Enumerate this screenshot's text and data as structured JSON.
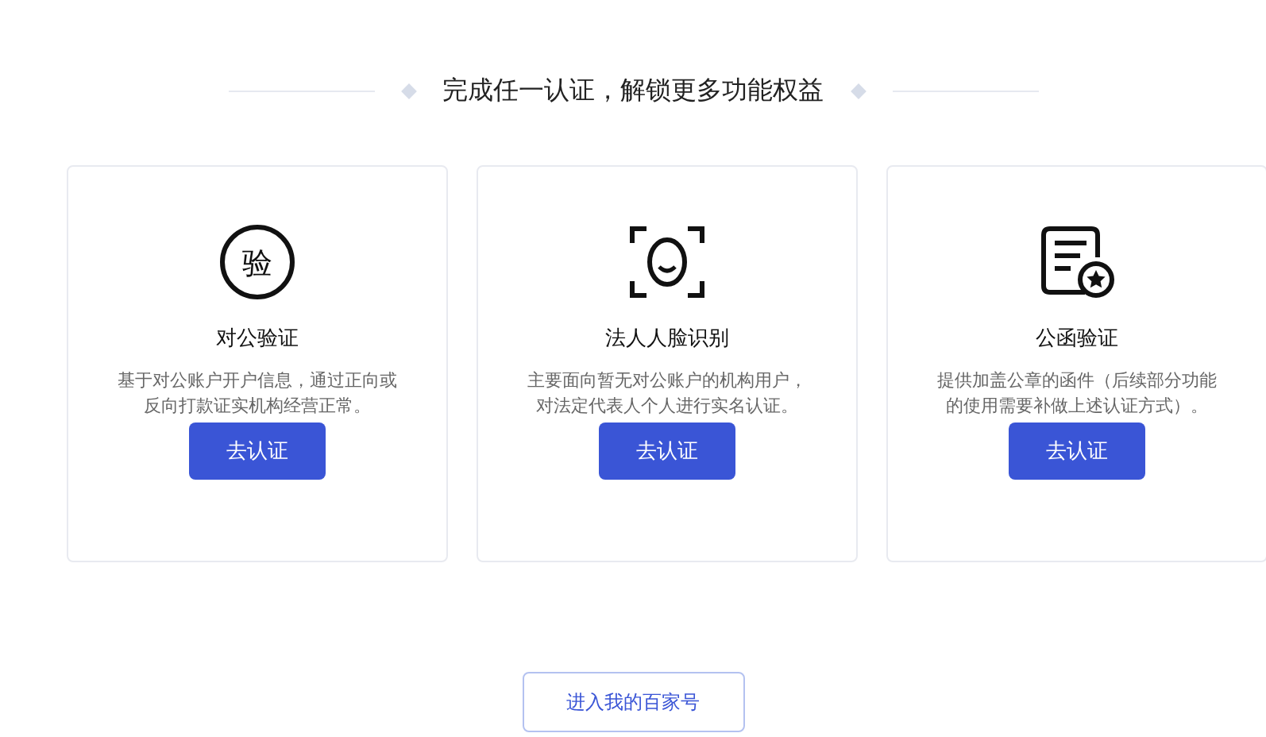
{
  "heading": "完成任一认证，解锁更多功能权益",
  "cards": [
    {
      "kind": "seal",
      "icon_text": "验",
      "title": "对公验证",
      "description": "基于对公账户开户信息，通过正向或反向打款证实机构经营正常。",
      "button": "去认证"
    },
    {
      "kind": "face",
      "title": "法人人脸识别",
      "description": "主要面向暂无对公账户的机构用户，对法定代表人个人进行实名认证。",
      "button": "去认证"
    },
    {
      "kind": "letter",
      "title": "公函验证",
      "description": "提供加盖公章的函件（后续部分功能的使用需要补做上述认证方式）。",
      "button": "去认证"
    }
  ],
  "footer_button": "进入我的百家号"
}
